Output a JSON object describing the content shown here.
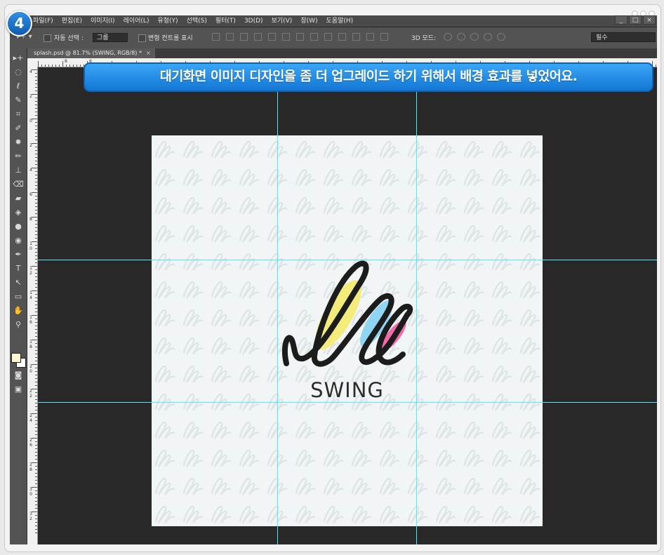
{
  "step_number": "4",
  "banner_text": "대기화면 이미지 디자인을 좀 더  업그레이드 하기 위해서 배경 효과를 넣었어요.",
  "menu": [
    "파일(F)",
    "편집(E)",
    "이미지(I)",
    "레이어(L)",
    "유형(Y)",
    "선택(S)",
    "필터(T)",
    "3D(D)",
    "보기(V)",
    "창(W)",
    "도움말(H)"
  ],
  "window_controls": [
    "_",
    "□",
    "×"
  ],
  "options": {
    "tool_glyph": "▸+ ▾",
    "auto_select_label": "자동 선택 :",
    "auto_select_value": "그룹",
    "transform_label": "변형 컨트롤 표시",
    "mode_3d_label": "3D 모드:",
    "workspace": "필수"
  },
  "document_tab": {
    "title": "splash.psd @ 81.7% (SWING, RGB/8) *",
    "close": "×"
  },
  "toolbox": [
    "▸+",
    "◌",
    "ℓ",
    "✎",
    "⌗",
    "✐",
    "✹",
    "✏",
    "⊥",
    "⌫",
    "▰",
    "◈",
    "●",
    "◉",
    "✒",
    "T",
    "↖",
    "▭",
    "✋",
    "⚲"
  ],
  "ruler_v_labels": [
    "4",
    "2",
    "0",
    "2",
    "4",
    "6",
    "8",
    "1 0",
    "1 2",
    "1 4",
    "1 6",
    "1 8",
    "2 0",
    "2 2",
    "2 4",
    "2 6",
    "2 8",
    "3 0",
    "3 2"
  ],
  "ruler_h_labels": [
    "8",
    "6"
  ],
  "artwork": {
    "brand_text": "SWING",
    "colors": {
      "yellow": "#f3ec7b",
      "blue": "#8ed6f2",
      "pink": "#f06ba8",
      "stroke": "#1c1c1c",
      "guide": "#53e8f2",
      "canvas": "#f2f5f6"
    }
  },
  "colors": {
    "banner": "#1c86e2",
    "step_badge": "#1f78cc",
    "ps_background": "#282828",
    "panel": "#535353"
  }
}
